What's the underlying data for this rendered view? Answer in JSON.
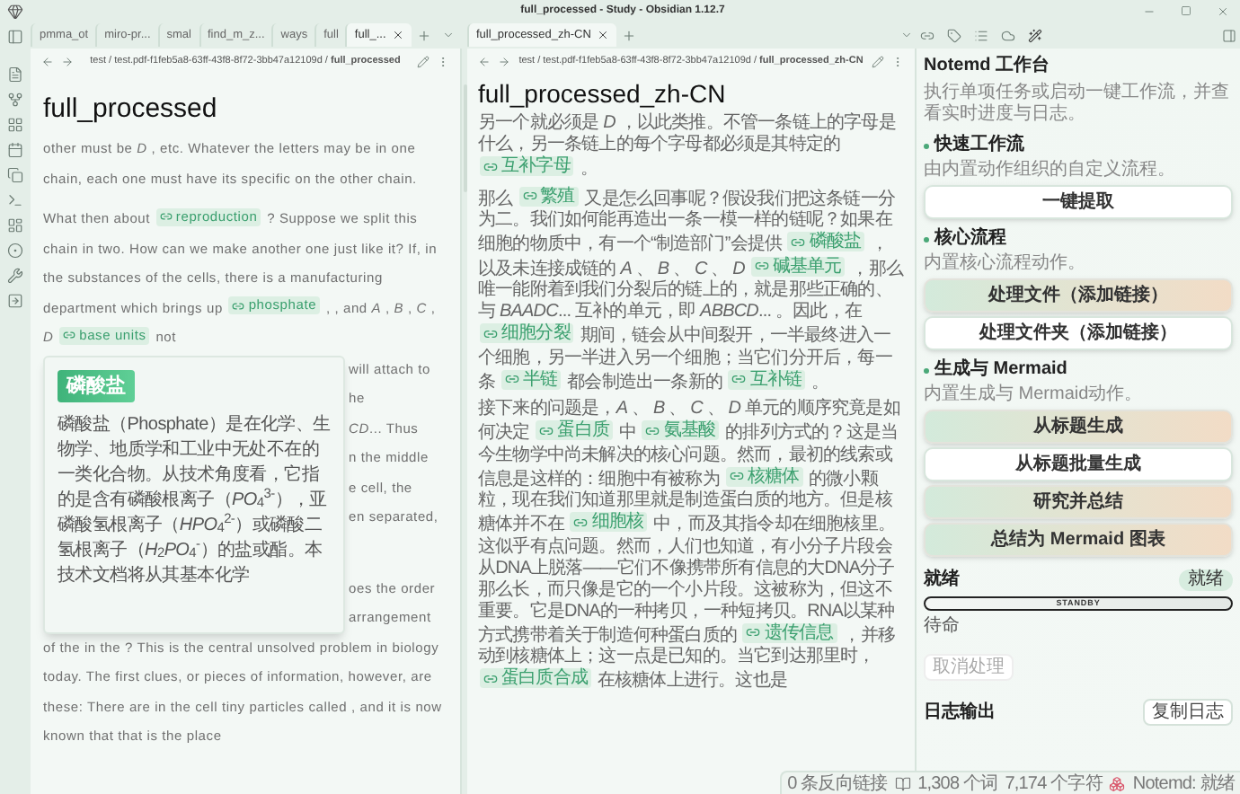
{
  "window": {
    "title": "full_processed - Study - Obsidian 1.12.7"
  },
  "left_tabs": [
    {
      "label": "pmma_ot",
      "selected": false
    },
    {
      "label": "miro-pr...",
      "selected": false
    },
    {
      "label": "smal",
      "selected": false
    },
    {
      "label": "find_m_z...",
      "selected": false
    },
    {
      "label": "ways",
      "selected": false
    },
    {
      "label": "full",
      "selected": false
    },
    {
      "label": "full_...",
      "selected": true
    }
  ],
  "right_tabs": [
    {
      "label": "full_processed_zh-CN",
      "selected": true
    }
  ],
  "left_pane": {
    "breadcrumb": "test / test.pdf-f1feb5a8-63ff-43f8-8f72-3bb47a12109d / **full_processed**",
    "title": "full_processed",
    "paragraphs": [
      [
        {
          "kind": "text",
          "text": "other must be *D* , etc. Whatever the letters may be in one chain, each one must have its specific on the other chain."
        }
      ],
      [
        {
          "kind": "text",
          "text": "What then about "
        },
        {
          "kind": "link",
          "text": "reproduction"
        },
        {
          "kind": "text",
          "text": " ? Suppose we split this chain in two. How can we make another one just like it? If, in the substances of the cells, there is a manufacturing department which brings up "
        },
        {
          "kind": "link",
          "text": "phosphate"
        },
        {
          "kind": "text",
          "text": " , , and *A* , *B* , *C* , *D* "
        },
        {
          "kind": "link",
          "text": "base units"
        },
        {
          "kind": "text",
          "text": " not"
        }
      ]
    ],
    "popup": {
      "badge": "磷酸盐",
      "body": "磷酸盐（Phosphate）是在化学、生物学、地质学和工业中无处不在的一类化合物。从技术角度看，它指的是含有磷酸根离子（*PO*$_{4}$$^{3-}$），亚磷酸氢根离子（*HPO*$_{4}$$^{2-}$）或磷酸二氢根离子（*H*$_{2}$*PO*$_{4}$$^{-}$）的盐或酯。本技术文档将从其基本化学"
    },
    "fragments": [
      [
        "will attach to",
        "he",
        "*CD*... Thus",
        "n the middle",
        "e cell, the",
        "en separated,"
      ],
      [
        "oes the order",
        "arrangement"
      ]
    ],
    "continuation": "of the in the ? This is the central unsolved problem in biology today. The first clues, or pieces of information, however, are these: There are in the cell tiny particles called , and it is now known that that is the place"
  },
  "right_pane": {
    "breadcrumb": "test / test.pdf-f1feb5a8-63ff-43f8-8f72-3bb47a12109d / **full_processed_zh-CN**",
    "title": "full_processed_zh-CN",
    "paragraphs": [
      [
        {
          "kind": "text",
          "text": "另一个就必须是 *D* ，以此类推。不管一条链上的字母是什么，另一条链上的每个字母都必须是其特定的 "
        },
        {
          "kind": "link",
          "text": "互补字母"
        },
        {
          "kind": "text",
          "text": " 。"
        }
      ],
      [
        {
          "kind": "text",
          "text": "那么 "
        },
        {
          "kind": "link",
          "text": "繁殖"
        },
        {
          "kind": "text",
          "text": " 又是怎么回事呢？假设我们把这条链一分为二。我们如何能再造出一条一模一样的链呢？如果在细胞的物质中，有一个“制造部门”会提供 "
        },
        {
          "kind": "link",
          "text": "磷酸盐"
        },
        {
          "kind": "text",
          "text": " ，以及未连接成链的 *A* 、 *B* 、 *C* 、 *D* "
        },
        {
          "kind": "link",
          "text": "碱基单元"
        },
        {
          "kind": "text",
          "text": " ，那么唯一能附着到我们分裂后的链上的，就是那些正确的、与 *BAADC*... 互补的单元，即 *ABBCD*... 。因此，在 "
        },
        {
          "kind": "link",
          "text": "细胞分裂"
        },
        {
          "kind": "text",
          "text": " 期间，链会从中间裂开，一半最终进入一个细胞，另一半进入另一个细胞；当它们分开后，每一条 "
        },
        {
          "kind": "link",
          "text": "半链"
        },
        {
          "kind": "text",
          "text": " 都会制造出一条新的 "
        },
        {
          "kind": "link",
          "text": "互补链"
        },
        {
          "kind": "text",
          "text": " 。"
        }
      ],
      [
        {
          "kind": "text",
          "text": "接下来的问题是，*A* 、 *B* 、 *C* 、 *D* 单元的顺序究竟是如何决定 "
        },
        {
          "kind": "link",
          "text": "蛋白质"
        },
        {
          "kind": "text",
          "text": " 中 "
        },
        {
          "kind": "link",
          "text": "氨基酸"
        },
        {
          "kind": "text",
          "text": " 的排列方式的？这是当今生物学中尚未解决的核心问题。然而，最初的线索或信息是这样的：细胞中有被称为 "
        },
        {
          "kind": "link",
          "text": "核糖体"
        },
        {
          "kind": "text",
          "text": " 的微小颗粒，现在我们知道那里就是制造蛋白质的地方。但是核糖体并不在 "
        },
        {
          "kind": "link",
          "text": "细胞核"
        },
        {
          "kind": "text",
          "text": " 中，而及其指令却在细胞核里。这似乎有点问题。然而，人们也知道，有小分子片段会从DNA上脱落——它们不像携带所有信息的大DNA分子那么长，而只像是它的一个小片段。这被称为，但这不重要。它是DNA的一种拷贝，一种短拷贝。RNA以某种方式携带着关于制造何种蛋白质的 "
        },
        {
          "kind": "link",
          "text": "遗传信息"
        },
        {
          "kind": "text",
          "text": " ，并移动到核糖体上；这一点是已知的。当它到达那里时， "
        },
        {
          "kind": "link",
          "text": "蛋白质合成"
        },
        {
          "kind": "text",
          "text": " 在核糖体上进行。这也是"
        }
      ]
    ]
  },
  "sidebar": {
    "title": "Notemd 工作台",
    "description": "执行单项任务或启动一键工作流，并查看实时进度与日志。",
    "sections": [
      {
        "heading": "快速工作流",
        "description": "由内置动作组织的自定义流程。",
        "buttons": [
          {
            "label": "一键提取",
            "kind": "plain"
          }
        ]
      },
      {
        "heading": "核心流程",
        "description": "内置核心流程动作。",
        "buttons": [
          {
            "label": "处理文件（添加链接）",
            "kind": "accent"
          },
          {
            "label": "处理文件夹（添加链接）",
            "kind": "plain"
          }
        ]
      },
      {
        "heading": "生成与 Mermaid",
        "description": "内置生成与 Mermaid动作。",
        "buttons": [
          {
            "label": "从标题生成",
            "kind": "accent"
          },
          {
            "label": "从标题批量生成",
            "kind": "plain"
          },
          {
            "label": "研究并总结",
            "kind": "accent"
          },
          {
            "label": "总结为 Mermaid 图表",
            "kind": "accent"
          }
        ]
      }
    ],
    "status": {
      "heading": "就绪",
      "badge": "就绪",
      "progress": {
        "label": "STANDBY",
        "level": 0
      },
      "state": "待命",
      "cancel_button": {
        "label": "取消处理",
        "disabled": true
      }
    },
    "log": {
      "heading": "日志输出",
      "copy_button": "复制日志"
    }
  },
  "status_bar": {
    "backlinks": "0 条反向链接",
    "words": "1,308 个词",
    "chars": "7,174 个字符",
    "plugin": "Notemd: 就绪"
  }
}
